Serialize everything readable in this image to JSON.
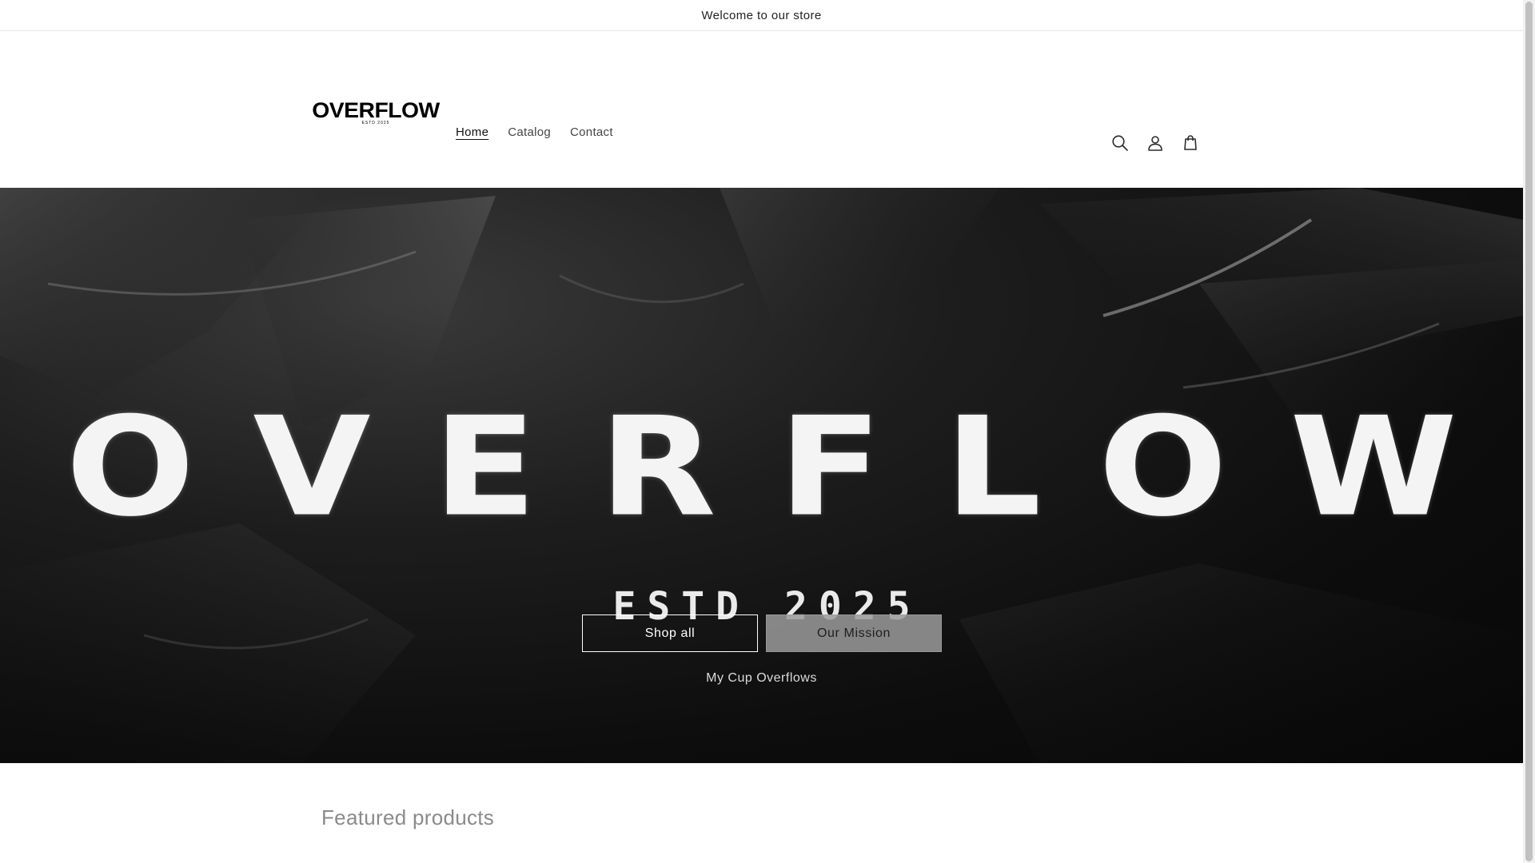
{
  "announcement": {
    "text": "Welcome to our store"
  },
  "header": {
    "logo": {
      "word": "OVERFLOW",
      "sub": "ESTD 2025"
    },
    "nav": [
      {
        "label": "Home",
        "active": true
      },
      {
        "label": "Catalog",
        "active": false
      },
      {
        "label": "Contact",
        "active": false
      }
    ],
    "icons": [
      "search-icon",
      "account-icon",
      "cart-icon"
    ]
  },
  "hero": {
    "title": "OVERFLOW",
    "estd": "ESTD 2025",
    "buttons": {
      "shop_all": "Shop all",
      "our_mission": "Our Mission"
    },
    "tagline": "My Cup Overflows"
  },
  "featured": {
    "title": "Featured products"
  },
  "colors": {
    "hero_background": "#0d0d0d",
    "button_solid": "#9b9b9b",
    "text": "#121212"
  }
}
